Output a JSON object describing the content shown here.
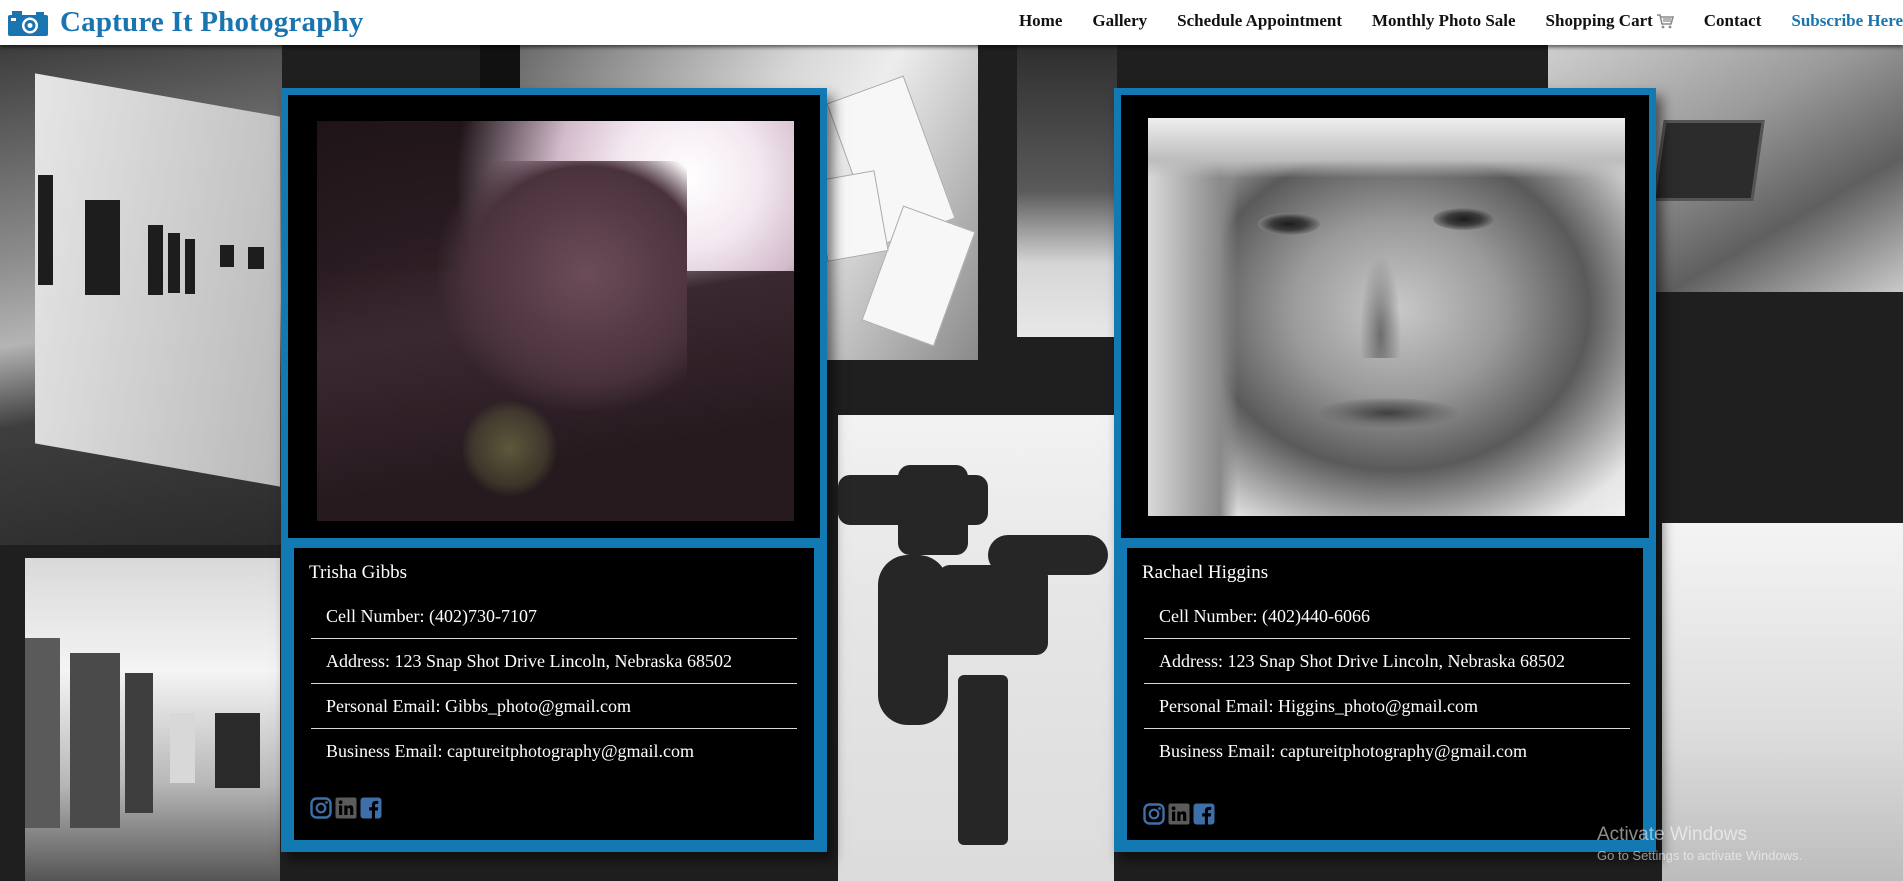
{
  "header": {
    "title": "Capture It Photography",
    "nav": [
      "Home",
      "Gallery",
      "Schedule Appointment",
      "Monthly Photo Sale",
      "Shopping Cart"
    ],
    "contact": "Contact",
    "subscribe": "Subscribe Here"
  },
  "people": [
    {
      "name": "Trisha Gibbs",
      "cell": "Cell Number: (402)730-7107",
      "address": "Address: 123 Snap Shot Drive Lincoln, Nebraska 68502",
      "personal_email": "Personal Email: Gibbs_photo@gmail.com",
      "business_email": "Business Email: captureitphotography@gmail.com"
    },
    {
      "name": "Rachael Higgins",
      "cell": "Cell Number: (402)440-6066",
      "address": "Address: 123 Snap Shot Drive Lincoln, Nebraska 68502",
      "personal_email": "Personal Email: Higgins_photo@gmail.com",
      "business_email": "Business Email: captureitphotography@gmail.com"
    }
  ],
  "social_icons": [
    "instagram-icon",
    "linkedin-icon",
    "facebook-icon"
  ],
  "os_overlay": {
    "line1": "Activate Windows",
    "line2": "Go to Settings to activate Windows."
  },
  "colors": {
    "brand_blue": "#1a74b0",
    "card_border": "#1279b3",
    "social_icon": "#3d6fa8"
  }
}
